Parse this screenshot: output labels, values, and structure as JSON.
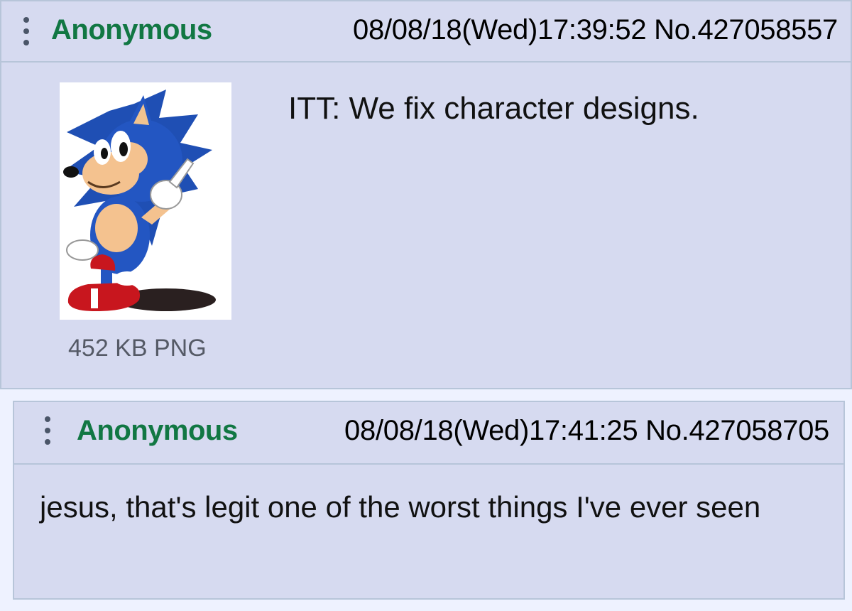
{
  "op": {
    "name": "Anonymous",
    "datetime_no": "08/08/18(Wed)17:39:52 No.427058557",
    "file_info": "452 KB PNG",
    "thumbnail_icon": "cartoon-hedgehog-image",
    "comment": "ITT: We fix character designs."
  },
  "reply": {
    "name": "Anonymous",
    "datetime_no": "08/08/18(Wed)17:41:25 No.427058705",
    "comment": "jesus, that's legit one of the worst things I've ever seen"
  },
  "colors": {
    "post_bg": "#d6daf0",
    "page_bg": "#eef2ff",
    "border": "#b7c5d9",
    "name_green": "#117743"
  }
}
